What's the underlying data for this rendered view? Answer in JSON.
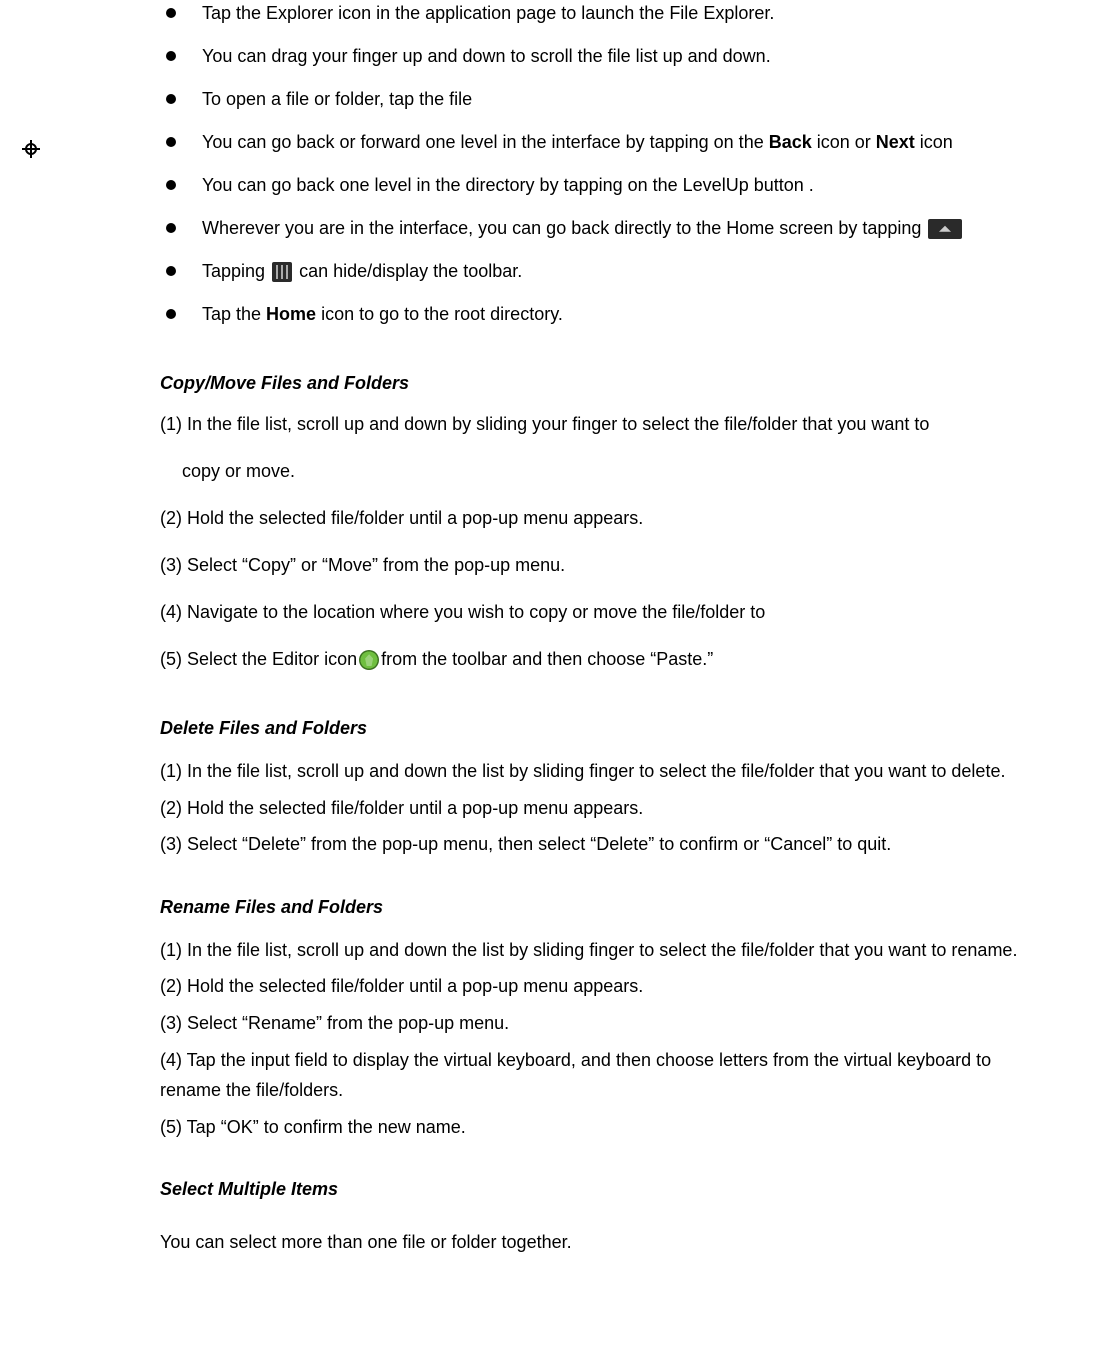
{
  "bullets": {
    "b1": "Tap the Explorer icon in the application page to launch the File Explorer.",
    "b2": "You can drag your finger up and down to scroll the file list up and down.",
    "b3": "To open a file or folder, tap the file",
    "b4_pre": "You can go back or forward one level in the interface by tapping on the ",
    "b4_back": "Back",
    "b4_mid": " icon or ",
    "b4_next": "Next",
    "b4_post": " icon",
    "b5": "You can go back one level in the directory by tapping on the LevelUp button    .",
    "b6": "Wherever you are in the interface, you can go back directly to the Home screen by tapping ",
    "b7_pre": "Tapping  ",
    "b7_post": " can hide/display the toolbar.",
    "b8_pre": "Tap the ",
    "b8_home": "Home",
    "b8_post": " icon to go to the root directory."
  },
  "copyMove": {
    "title": "Copy/Move Files and Folders",
    "p1": "(1) In the file list, scroll up and down by sliding your finger to select the file/folder that you want to",
    "p1b": "copy or move.",
    "p2": "(2) Hold the selected file/folder until a pop-up menu appears.",
    "p3": "(3) Select “Copy” or “Move” from the pop-up menu.",
    "p4": "(4) Navigate to the location where you wish to copy or move the file/folder to",
    "p5_pre": "(5) Select the Editor icon",
    "p5_post": "from the toolbar and then choose “Paste.”"
  },
  "deleteSec": {
    "title": "Delete Files and Folders",
    "p1": "(1)   In the file list, scroll up and down the list by sliding finger to select the file/folder that you want to delete.",
    "p2": "(2)   Hold the selected file/folder until a pop-up menu appears.",
    "p3": "(3)   Select “Delete” from the pop-up menu, then select “Delete” to confirm or “Cancel” to quit."
  },
  "renameSec": {
    "title": "Rename Files and Folders",
    "p1": "(1)   In the file list, scroll up and down the list by sliding finger to select the file/folder that you want to rename.",
    "p2": "(2)   Hold the selected file/folder until a pop-up menu appears.",
    "p3": "(3)   Select “Rename” from the pop-up menu.",
    "p4": "(4)   Tap the input field to display the virtual keyboard, and then choose letters from the virtual keyboard to rename the file/folders.",
    "p5": "(5)   Tap “OK” to confirm the new name."
  },
  "selectMulti": {
    "title": "Select Multiple Items",
    "p1": "You can select more than one file or folder together."
  }
}
